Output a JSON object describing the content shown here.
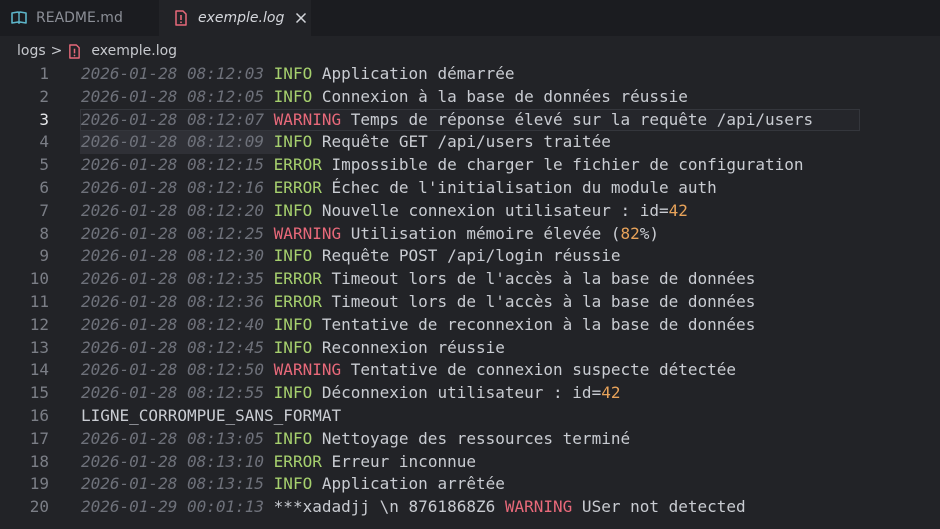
{
  "tabs": [
    {
      "label": "README.md",
      "icon": "book-icon",
      "active": false
    },
    {
      "label": "exemple.log",
      "icon": "warning-file-icon",
      "active": true
    }
  ],
  "breadcrumb": {
    "folder": "logs",
    "separator": ">",
    "file": "exemple.log"
  },
  "colors": {
    "info": "#a6d06e",
    "warning": "#e8697a",
    "number": "#e8a35a",
    "timestamp": "#6e717a",
    "text": "#c9ccd2",
    "background": "#222327"
  },
  "current_line": 3,
  "lines": [
    {
      "n": "1",
      "ts": "2026-01-28 08:12:03",
      "lvl": "INFO",
      "parts": [
        {
          "t": "Application démarrée"
        }
      ]
    },
    {
      "n": "2",
      "ts": "2026-01-28 08:12:05",
      "lvl": "INFO",
      "parts": [
        {
          "t": "Connexion à la base de données réussie"
        }
      ]
    },
    {
      "n": "3",
      "ts": "2026-01-28 08:12:07",
      "lvl": "WARNING",
      "parts": [
        {
          "t": "Temps de réponse élevé sur la requête /api/users"
        }
      ]
    },
    {
      "n": "4",
      "ts": "2026-01-28 08:12:09",
      "lvl": "INFO",
      "parts": [
        {
          "t": "Requête GET /api/users traitée"
        }
      ]
    },
    {
      "n": "5",
      "ts": "2026-01-28 08:12:15",
      "lvl": "ERROR",
      "parts": [
        {
          "t": "Impossible de charger le fichier de configuration"
        }
      ]
    },
    {
      "n": "6",
      "ts": "2026-01-28 08:12:16",
      "lvl": "ERROR",
      "parts": [
        {
          "t": "Échec de l'initialisation du module auth"
        }
      ]
    },
    {
      "n": "7",
      "ts": "2026-01-28 08:12:20",
      "lvl": "INFO",
      "parts": [
        {
          "t": "Nouvelle connexion utilisateur : id="
        },
        {
          "t": "42",
          "num": true
        }
      ]
    },
    {
      "n": "8",
      "ts": "2026-01-28 08:12:25",
      "lvl": "WARNING",
      "parts": [
        {
          "t": "Utilisation mémoire élevée ("
        },
        {
          "t": "82",
          "num": true
        },
        {
          "t": "%)"
        }
      ]
    },
    {
      "n": "9",
      "ts": "2026-01-28 08:12:30",
      "lvl": "INFO",
      "parts": [
        {
          "t": "Requête POST /api/login réussie"
        }
      ]
    },
    {
      "n": "10",
      "ts": "2026-01-28 08:12:35",
      "lvl": "ERROR",
      "parts": [
        {
          "t": "Timeout lors de l'accès à la base de données"
        }
      ]
    },
    {
      "n": "11",
      "ts": "2026-01-28 08:12:36",
      "lvl": "ERROR",
      "parts": [
        {
          "t": "Timeout lors de l'accès à la base de données"
        }
      ]
    },
    {
      "n": "12",
      "ts": "2026-01-28 08:12:40",
      "lvl": "INFO",
      "parts": [
        {
          "t": "Tentative de reconnexion à la base de données"
        }
      ]
    },
    {
      "n": "13",
      "ts": "2026-01-28 08:12:45",
      "lvl": "INFO",
      "parts": [
        {
          "t": "Reconnexion réussie"
        }
      ]
    },
    {
      "n": "14",
      "ts": "2026-01-28 08:12:50",
      "lvl": "WARNING",
      "parts": [
        {
          "t": "Tentative de connexion suspecte détectée"
        }
      ]
    },
    {
      "n": "15",
      "ts": "2026-01-28 08:12:55",
      "lvl": "INFO",
      "parts": [
        {
          "t": "Déconnexion utilisateur : id="
        },
        {
          "t": "42",
          "num": true
        }
      ]
    },
    {
      "n": "16",
      "ts": "",
      "lvl": "",
      "parts": [
        {
          "t": "LIGNE_CORROMPUE_SANS_FORMAT"
        }
      ]
    },
    {
      "n": "17",
      "ts": "2026-01-28 08:13:05",
      "lvl": "INFO",
      "parts": [
        {
          "t": "Nettoyage des ressources terminé"
        }
      ]
    },
    {
      "n": "18",
      "ts": "2026-01-28 08:13:10",
      "lvl": "ERROR",
      "parts": [
        {
          "t": "Erreur inconnue"
        }
      ]
    },
    {
      "n": "19",
      "ts": "2026-01-28 08:13:15",
      "lvl": "INFO",
      "parts": [
        {
          "t": "Application arrêtée"
        }
      ]
    },
    {
      "n": "20",
      "ts": "2026-01-29 00:01:13",
      "lvl": "",
      "parts": [
        {
          "t": "***xadadjj \\n 8761868Z6 "
        },
        {
          "t": "WARNING",
          "warn": true
        },
        {
          "t": " USer not detected"
        }
      ]
    }
  ]
}
